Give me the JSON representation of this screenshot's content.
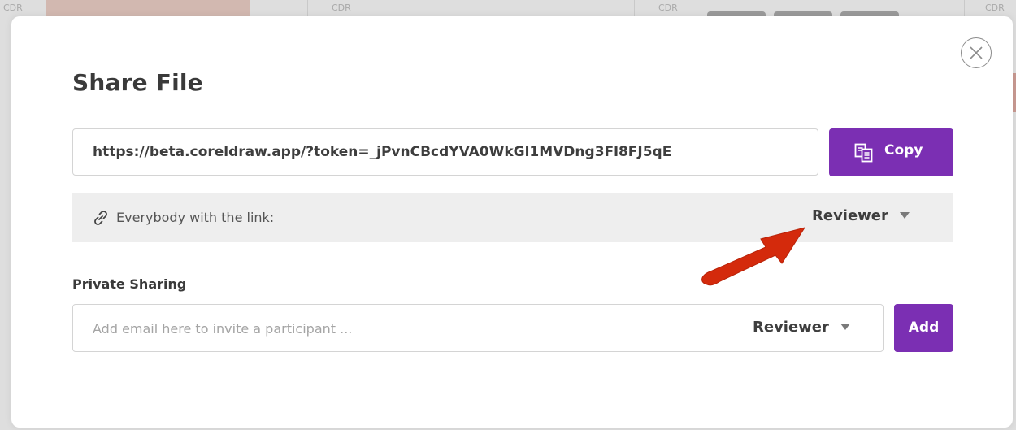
{
  "background": {
    "format_labels": [
      "CDR",
      "CDR",
      "CDR",
      "CDR"
    ]
  },
  "dialog": {
    "title": "Share File",
    "close_icon": "close-circle-icon",
    "share_link": {
      "url": "https://beta.coreldraw.app/?token=_jPvnCBcdYVA0WkGl1MVDng3Fl8FJ5qE",
      "copy_label": "Copy",
      "copy_icon": "copy-icon"
    },
    "link_permission": {
      "icon": "link-icon",
      "label": "Everybody with the link:",
      "value": "Reviewer"
    },
    "private_sharing": {
      "heading": "Private Sharing",
      "email_placeholder": "Add email here to invite a participant ...",
      "email_value": "",
      "role_value": "Reviewer",
      "add_label": "Add"
    }
  },
  "colors": {
    "accent": "#7b2fb3",
    "row_background": "#eeeeee",
    "annotation_arrow": "#d42a0c"
  }
}
